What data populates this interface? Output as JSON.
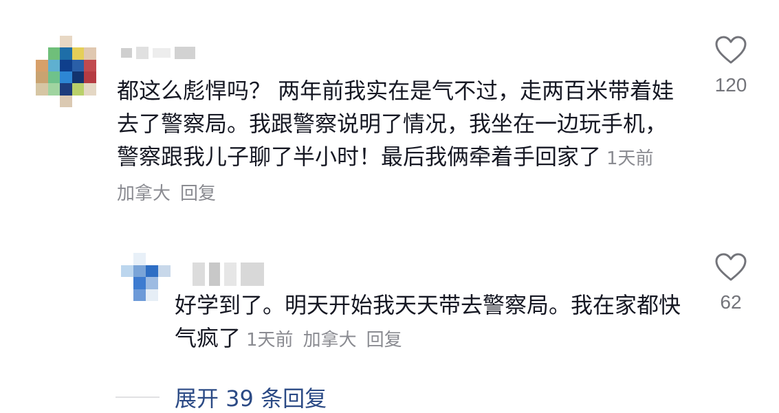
{
  "comments": [
    {
      "text": "都这么彪悍吗？ 两年前我实在是气不过，走两百米带着娃去了警察局。我跟警察说明了情况，我坐在一边玩手机，警察跟我儿子聊了半小时！最后我俩牵着手回家了",
      "time": "1天前",
      "location": "加拿大",
      "reply_label": "回复",
      "likes": "120",
      "avatar_colors": [
        "#ffffff",
        "#ffffff",
        "#e8d8c4",
        "#ffffff",
        "#ffffff",
        "#ffffff",
        "#6fbf7a",
        "#1e6ea8",
        "#e5cf58",
        "#e0c8b0",
        "#d7a06a",
        "#5fb0d0",
        "#0f3f8c",
        "#2a5fa8",
        "#c14a4f",
        "#c9a371",
        "#6fc28b",
        "#2d86d4",
        "#12336e",
        "#b53b42",
        "#d6c6a4",
        "#a0d4a0",
        "#1d3c7c",
        "#b9d06a",
        "#e4d7c4",
        "#ffffff",
        "#ffffff",
        "#dbc9b2",
        "#ffffff",
        "#ffffff"
      ],
      "name_blocks": [
        "#cfcfcf",
        "#e0e0e0",
        "#ededed",
        "#d2d2d2"
      ]
    },
    {
      "text": "好学到了。明天开始我天天带去警察局。我在家都快气疯了",
      "time": "1天前",
      "location": "加拿大",
      "reply_label": "回复",
      "likes": "62",
      "avatar_colors": [
        "#ffffff",
        "#e8f0f8",
        "#ffffff",
        "#ffffff",
        "#bcd6ee",
        "#7aa4d8",
        "#2e6ec4",
        "#c8d8ea",
        "#ffffff",
        "#3d7bd0",
        "#9dbbe2",
        "#ffffff",
        "#ffffff",
        "#6d9ad8",
        "#e6eef6",
        "#ffffff"
      ],
      "name_blocks": [
        "#dcdcdc",
        "#c8c8c8",
        "#e6e6e6",
        "#d8d8d8"
      ]
    }
  ],
  "expand_replies": "展开 39 条回复"
}
